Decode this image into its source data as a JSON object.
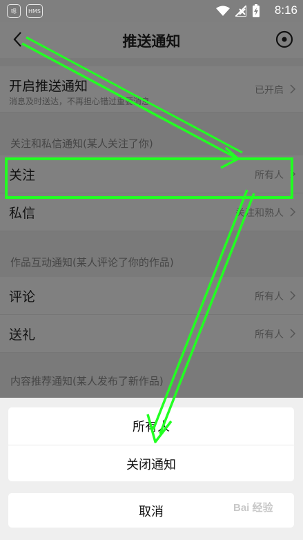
{
  "status_bar": {
    "time": "8:16",
    "app_icon_1": "嗯",
    "app_icon_2": "HMS"
  },
  "nav": {
    "title": "推送通知"
  },
  "push_row": {
    "label": "开启推送通知",
    "sub": "消息及时送达，不再担心错过重要消息",
    "value": "已开启"
  },
  "section_follow": {
    "header": "关注和私信通知(某人关注了你)",
    "rows": [
      {
        "label": "关注",
        "value": "所有人"
      },
      {
        "label": "私信",
        "value": "关注和熟人"
      }
    ]
  },
  "section_works": {
    "header": "作品互动通知(某人评论了你的作品)",
    "rows": [
      {
        "label": "评论",
        "value": "所有人"
      },
      {
        "label": "送礼",
        "value": "所有人"
      }
    ]
  },
  "section_recommend": {
    "header": "内容推荐通知(某人发布了新作品)"
  },
  "action_sheet": {
    "option_all": "所有人",
    "option_off": "关闭通知",
    "cancel": "取消"
  },
  "watermark": "Bai 经验",
  "colors": {
    "dim_overlay": "#808080",
    "annotation": "#22ff22",
    "sheet_bg": "#efefef"
  }
}
